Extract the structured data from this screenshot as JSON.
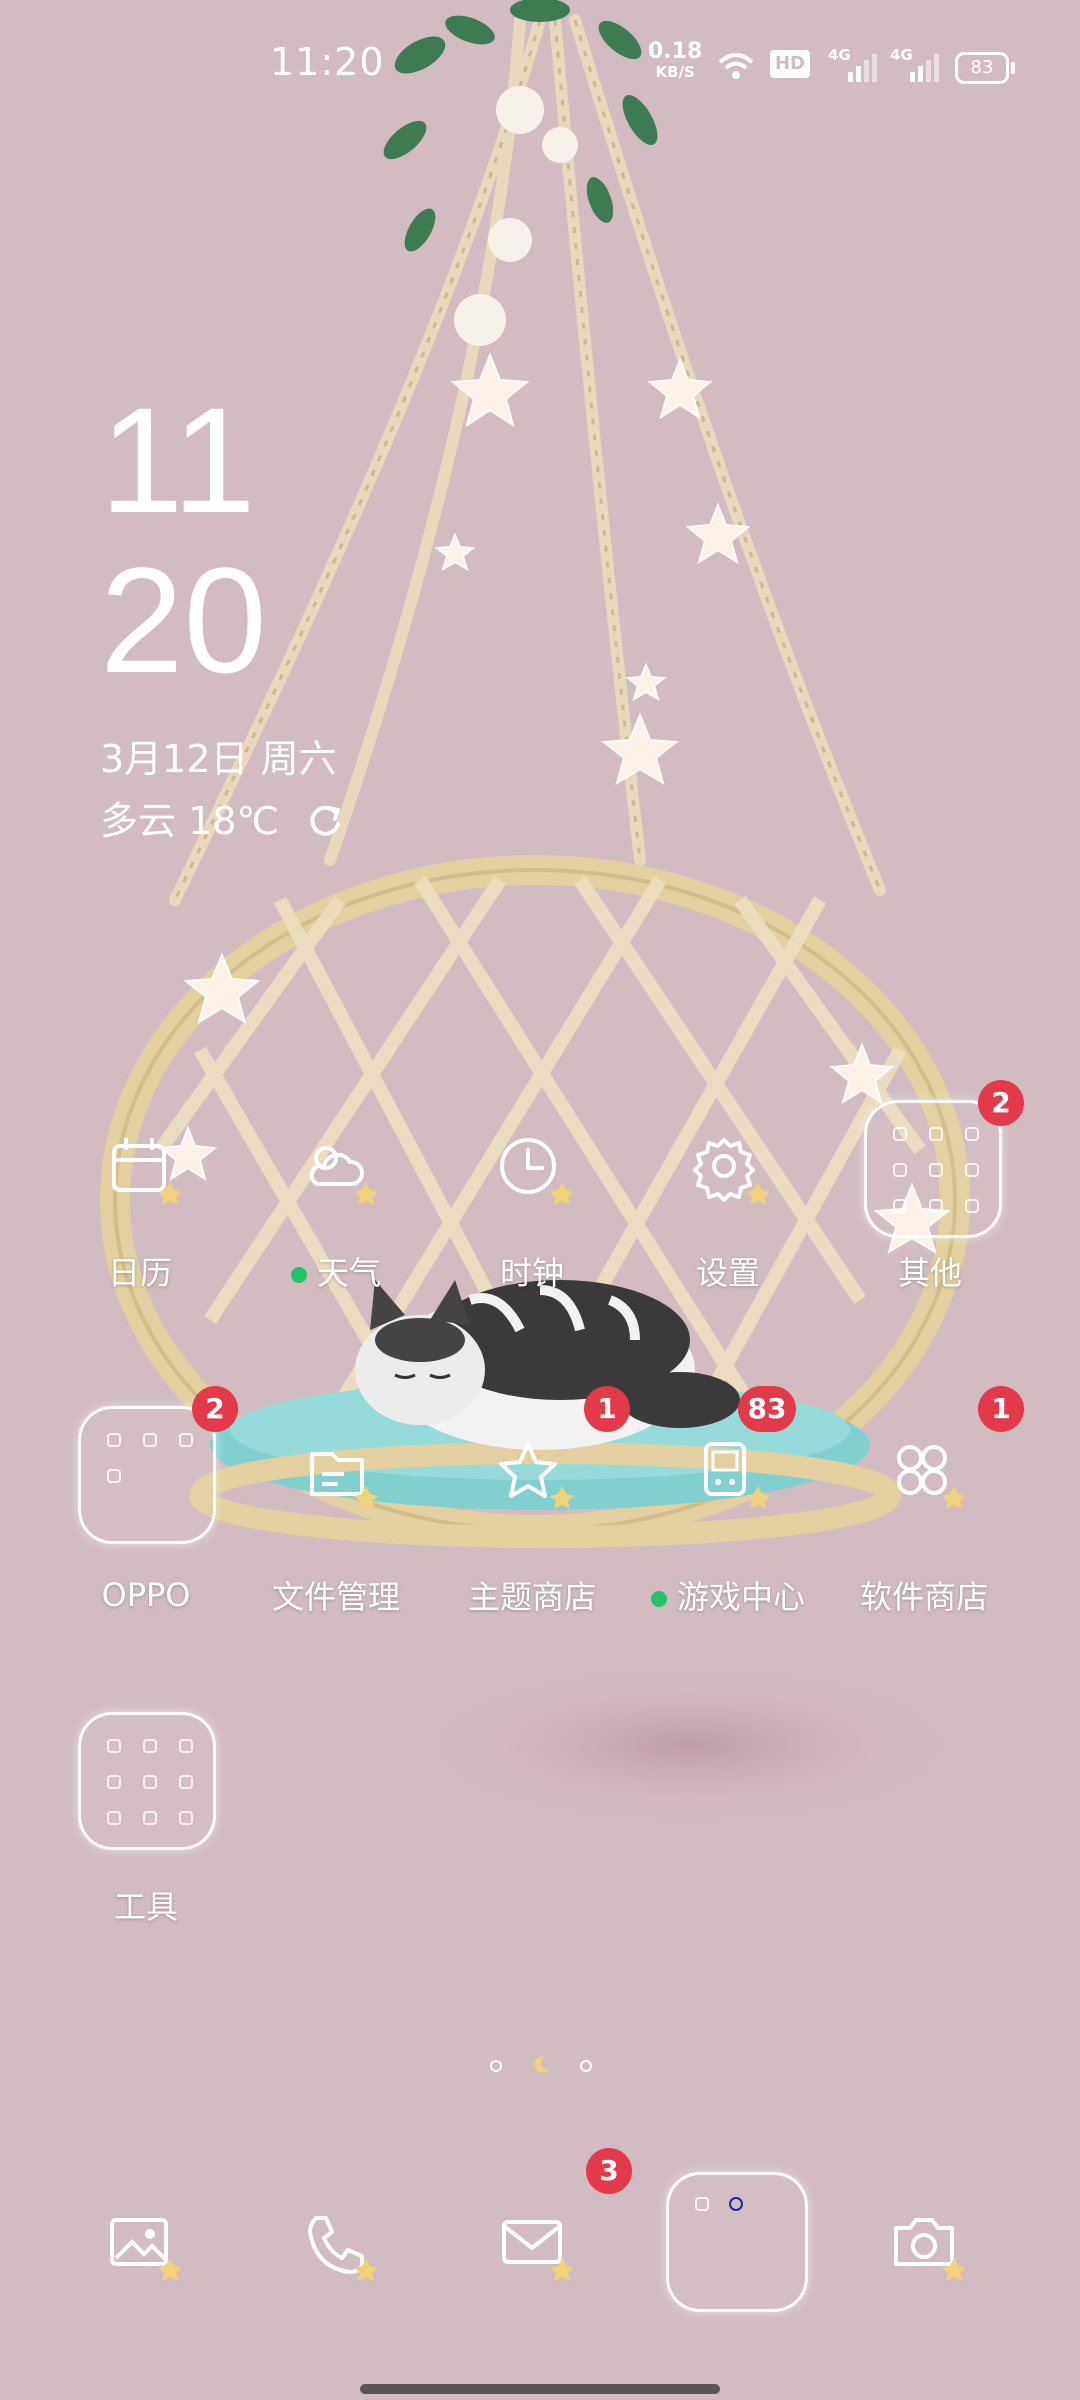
{
  "status_bar": {
    "time": "11:20",
    "net_speed_value": "0.18",
    "net_speed_unit": "KB/S",
    "hd_label": "HD",
    "signal1_label": "4G",
    "signal2_label": "4G",
    "battery": "83"
  },
  "clock_widget": {
    "hour": "11",
    "minute": "20",
    "date": "3月12日 周六",
    "weather": "多云 18℃"
  },
  "apps_row1": [
    {
      "label": "日历",
      "badge": ""
    },
    {
      "label": "天气",
      "badge": ""
    },
    {
      "label": "时钟",
      "badge": ""
    },
    {
      "label": "设置",
      "badge": ""
    },
    {
      "label": "其他",
      "badge": "2"
    }
  ],
  "apps_row2": [
    {
      "label": "OPPO",
      "badge": "2"
    },
    {
      "label": "文件管理",
      "badge": ""
    },
    {
      "label": "主题商店",
      "badge": "1"
    },
    {
      "label": "游戏中心",
      "badge": "83"
    },
    {
      "label": "软件商店",
      "badge": "1"
    }
  ],
  "apps_row3": [
    {
      "label": "工具",
      "badge": ""
    }
  ],
  "dock": {
    "messages_badge": "3"
  },
  "colors": {
    "background": "#d2bcc1",
    "badge": "#e23a4a",
    "online_dot": "#22c36b"
  }
}
